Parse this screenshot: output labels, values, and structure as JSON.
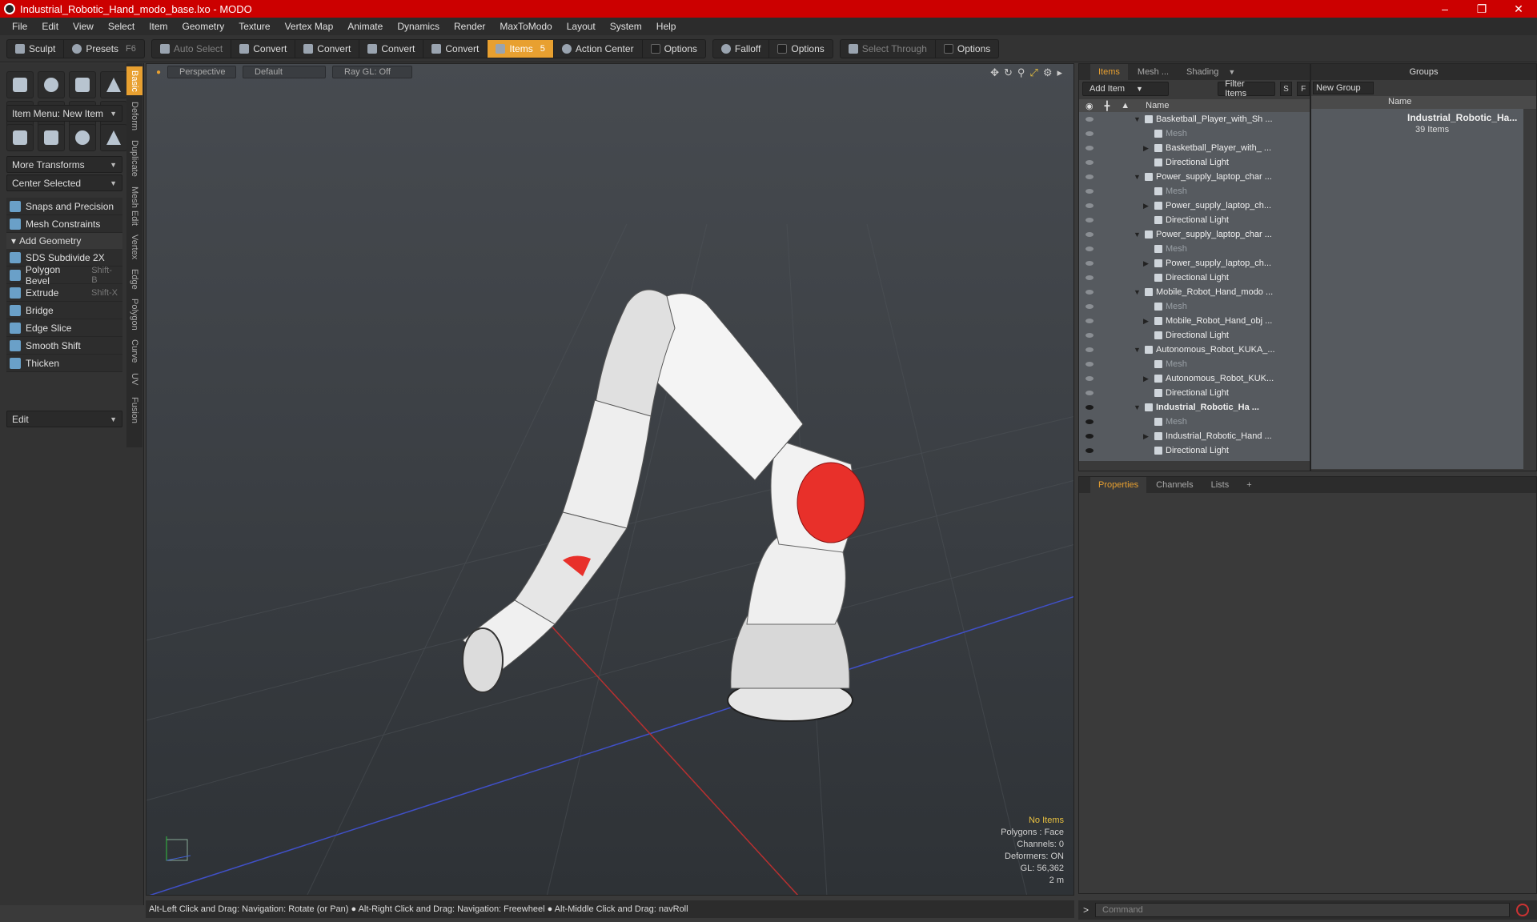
{
  "window": {
    "title": "Industrial_Robotic_Hand_modo_base.lxo - MODO"
  },
  "menu": [
    "File",
    "Edit",
    "View",
    "Select",
    "Item",
    "Geometry",
    "Texture",
    "Vertex Map",
    "Animate",
    "Dynamics",
    "Render",
    "MaxToModo",
    "Layout",
    "System",
    "Help"
  ],
  "toolbar": {
    "sculpt": "Sculpt",
    "presets": "Presets",
    "presets_key": "F6",
    "auto_select": "Auto Select",
    "convert1": "Convert",
    "convert2": "Convert",
    "convert3": "Convert",
    "convert4": "Convert",
    "items": "Items",
    "items_key": "5",
    "action_center": "Action Center",
    "options1": "Options",
    "falloff": "Falloff",
    "options2": "Options",
    "select_through": "Select Through",
    "options3": "Options"
  },
  "left": {
    "item_menu": "Item Menu: New Item",
    "more_transforms": "More Transforms",
    "center_selected": "Center Selected",
    "snaps": "Snaps and Precision",
    "mesh_constraints": "Mesh Constraints",
    "add_geometry": "Add Geometry",
    "tools": [
      {
        "label": "SDS Subdivide 2X",
        "key": ""
      },
      {
        "label": "Polygon Bevel",
        "key": "Shift-B"
      },
      {
        "label": "Extrude",
        "key": "Shift-X"
      },
      {
        "label": "Bridge",
        "key": ""
      },
      {
        "label": "Edge Slice",
        "key": ""
      },
      {
        "label": "Smooth Shift",
        "key": ""
      },
      {
        "label": "Thicken",
        "key": ""
      }
    ],
    "edit": "Edit",
    "vtabs": [
      "Basic",
      "Deform",
      "Duplicate",
      "Mesh Edit",
      "Vertex",
      "Edge",
      "Polygon",
      "Curve",
      "UV",
      "Fusion"
    ]
  },
  "viewport": {
    "tab_perspective": "Perspective",
    "tab_default": "Default",
    "tab_raygl": "Ray GL: Off",
    "info": {
      "no_items": "No Items",
      "polygons": "Polygons : Face",
      "channels": "Channels: 0",
      "deformers": "Deformers: ON",
      "gl": "GL: 56,362",
      "scale": "2 m"
    }
  },
  "status": "Alt-Left Click and Drag: Navigation: Rotate (or Pan) ● Alt-Right Click and Drag: Navigation: Freewheel ● Alt-Middle Click and Drag: navRoll",
  "items_panel": {
    "tabs": [
      "Items",
      "Mesh ...",
      "Shading"
    ],
    "add_item": "Add Item",
    "filter_items": "Filter Items",
    "s": "S",
    "f": "F",
    "col_name": "Name",
    "rows": [
      {
        "label": "Basketball_Player_with_Sh ...",
        "level": 0,
        "kind": "scene",
        "eye": "off"
      },
      {
        "label": "Mesh",
        "level": 1,
        "kind": "mesh",
        "eye": "off"
      },
      {
        "label": "Basketball_Player_with_ ...",
        "level": 1,
        "kind": "group",
        "eye": "off"
      },
      {
        "label": "Directional Light",
        "level": 1,
        "kind": "light",
        "eye": "off"
      },
      {
        "label": "Power_supply_laptop_char ...",
        "level": 0,
        "kind": "scene",
        "eye": "off"
      },
      {
        "label": "Mesh",
        "level": 1,
        "kind": "mesh",
        "eye": "off"
      },
      {
        "label": "Power_supply_laptop_ch...",
        "level": 1,
        "kind": "group",
        "eye": "off"
      },
      {
        "label": "Directional Light",
        "level": 1,
        "kind": "light",
        "eye": "off"
      },
      {
        "label": "Power_supply_laptop_char ...",
        "level": 0,
        "kind": "scene",
        "eye": "off"
      },
      {
        "label": "Mesh",
        "level": 1,
        "kind": "mesh",
        "eye": "off"
      },
      {
        "label": "Power_supply_laptop_ch...",
        "level": 1,
        "kind": "group",
        "eye": "off"
      },
      {
        "label": "Directional Light",
        "level": 1,
        "kind": "light",
        "eye": "off"
      },
      {
        "label": "Mobile_Robot_Hand_modo ...",
        "level": 0,
        "kind": "scene",
        "eye": "off"
      },
      {
        "label": "Mesh",
        "level": 1,
        "kind": "mesh",
        "eye": "off"
      },
      {
        "label": "Mobile_Robot_Hand_obj ...",
        "level": 1,
        "kind": "group",
        "eye": "off"
      },
      {
        "label": "Directional Light",
        "level": 1,
        "kind": "light",
        "eye": "off"
      },
      {
        "label": "Autonomous_Robot_KUKA_...",
        "level": 0,
        "kind": "scene",
        "eye": "off"
      },
      {
        "label": "Mesh",
        "level": 1,
        "kind": "mesh",
        "eye": "off"
      },
      {
        "label": "Autonomous_Robot_KUK...",
        "level": 1,
        "kind": "group",
        "eye": "off"
      },
      {
        "label": "Directional Light",
        "level": 1,
        "kind": "light",
        "eye": "off"
      },
      {
        "label": "Industrial_Robotic_Ha ...",
        "level": 0,
        "kind": "scene",
        "eye": "on",
        "bold": true
      },
      {
        "label": "Mesh",
        "level": 1,
        "kind": "mesh",
        "eye": "on"
      },
      {
        "label": "Industrial_Robotic_Hand ...",
        "level": 1,
        "kind": "group",
        "eye": "on"
      },
      {
        "label": "Directional Light",
        "level": 1,
        "kind": "light",
        "eye": "on"
      }
    ]
  },
  "groups_panel": {
    "title": "Groups",
    "new_group": "New Group",
    "col_name": "Name",
    "item": "Industrial_Robotic_Ha...",
    "count": "39 Items"
  },
  "props_panel": {
    "tabs": [
      "Properties",
      "Channels",
      "Lists"
    ],
    "add": "+"
  },
  "command": {
    "placeholder": "Command",
    "prompt": ">"
  }
}
